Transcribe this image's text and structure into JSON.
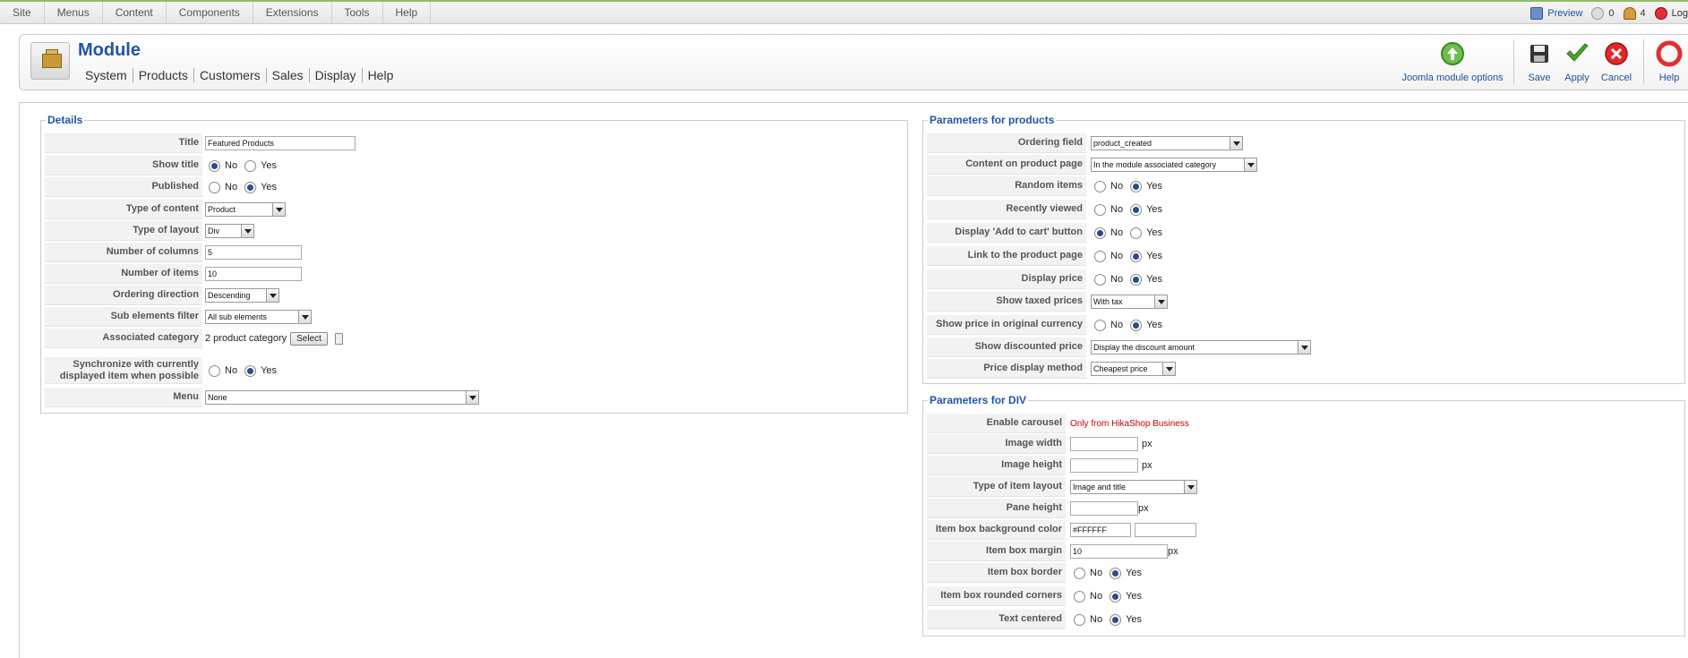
{
  "topbar": {
    "menu": [
      "Site",
      "Menus",
      "Content",
      "Components",
      "Extensions",
      "Tools",
      "Help"
    ],
    "preview": "Preview",
    "messages_count": "0",
    "users_count": "4",
    "logout": "Log"
  },
  "header": {
    "title": "Module",
    "submenu": [
      "System",
      "Products",
      "Customers",
      "Sales",
      "Display",
      "Help"
    ],
    "toolbar": {
      "options": "Joomla module options",
      "save": "Save",
      "apply": "Apply",
      "cancel": "Cancel",
      "help": "Help"
    }
  },
  "details": {
    "legend": "Details",
    "title_label": "Title",
    "title_value": "Featured Products",
    "show_title_label": "Show title",
    "published_label": "Published",
    "no": "No",
    "yes": "Yes",
    "type_content_label": "Type of content",
    "type_content_value": "Product",
    "type_layout_label": "Type of layout",
    "type_layout_value": "Div",
    "num_columns_label": "Number of columns",
    "num_columns_value": "5",
    "num_items_label": "Number of items",
    "num_items_value": "10",
    "ordering_direction_label": "Ordering direction",
    "ordering_direction_value": "Descending",
    "sub_elements_label": "Sub elements filter",
    "sub_elements_value": "All sub elements",
    "assoc_category_label": "Associated category",
    "assoc_category_value": "2 product category",
    "select_button": "Select",
    "sync_label_1": "Synchronize with currently",
    "sync_label_2": "displayed item when possible",
    "menu_label": "Menu",
    "menu_value": "None"
  },
  "products": {
    "legend": "Parameters for products",
    "ordering_field_label": "Ordering field",
    "ordering_field_value": "product_created",
    "content_page_label": "Content on product page",
    "content_page_value": "In the module associated category",
    "random_label": "Random items",
    "recent_label": "Recently viewed",
    "addcart_label": "Display 'Add to cart' button",
    "link_label": "Link to the product page",
    "price_label": "Display price",
    "taxed_label": "Show taxed prices",
    "taxed_value": "With tax",
    "orig_currency_label": "Show price in original currency",
    "discounted_label": "Show discounted price",
    "discounted_value": "Display the discount amount",
    "price_method_label": "Price display method",
    "price_method_value": "Cheapest price",
    "no": "No",
    "yes": "Yes"
  },
  "div": {
    "legend": "Parameters for DIV",
    "carousel_label": "Enable carousel",
    "carousel_value": "Only from HikaShop Business",
    "img_width_label": "Image width",
    "img_height_label": "Image height",
    "item_layout_label": "Type of item layout",
    "item_layout_value": "Image and title",
    "pane_height_label": "Pane height",
    "bg_color_label": "Item box background color",
    "bg_color_value": "#FFFFFF",
    "margin_label": "Item box margin",
    "margin_value": "10",
    "border_label": "Item box border",
    "rounded_label": "Item box rounded corners",
    "centered_label": "Text centered",
    "px": "px",
    "no": "No",
    "yes": "Yes"
  },
  "colors": {
    "title_blue": "#1f55a8",
    "radio_checked": "#2a4d8a",
    "warning_red": "#cc0000"
  }
}
